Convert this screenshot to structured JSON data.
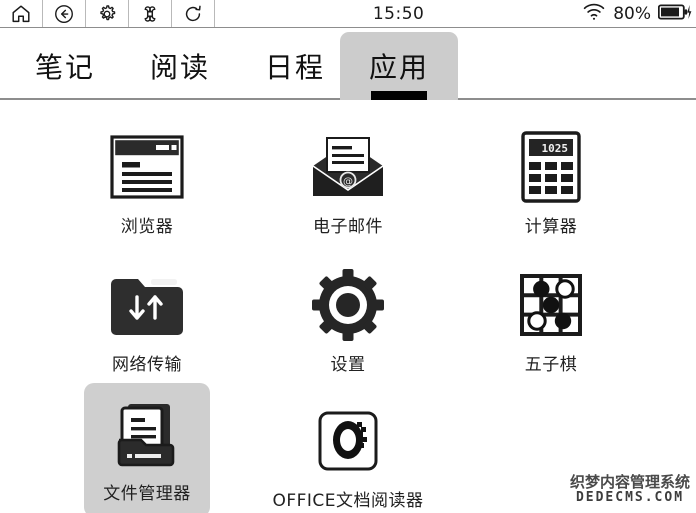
{
  "statusbar": {
    "buttons": [
      {
        "name": "home-icon",
        "label": "home"
      },
      {
        "name": "back-icon",
        "label": "back"
      },
      {
        "name": "gear-icon",
        "label": "settings"
      },
      {
        "name": "apps-grid-icon",
        "label": "apps"
      },
      {
        "name": "refresh-icon",
        "label": "refresh"
      }
    ],
    "time": "15:50",
    "wifi_icon": "wifi-icon",
    "battery_percent": "80%",
    "battery_icon": "battery-charging-icon"
  },
  "tabs": [
    {
      "label": "笔记",
      "active": false
    },
    {
      "label": "阅读",
      "active": false
    },
    {
      "label": "日程",
      "active": false
    },
    {
      "label": "应用",
      "active": true
    }
  ],
  "apps": [
    {
      "label": "浏览器",
      "icon": "browser-icon",
      "selected": false
    },
    {
      "label": "电子邮件",
      "icon": "email-icon",
      "selected": false
    },
    {
      "label": "计算器",
      "icon": "calculator-icon",
      "selected": false,
      "display_value": "1025"
    },
    {
      "label": "网络传输",
      "icon": "network-transfer-folder-icon",
      "selected": false
    },
    {
      "label": "设置",
      "icon": "gear-icon",
      "selected": false
    },
    {
      "label": "五子棋",
      "icon": "gomoku-board-icon",
      "selected": false
    },
    {
      "label": "文件管理器",
      "icon": "file-manager-icon",
      "selected": true
    },
    {
      "label": "OFFICE文档阅读器",
      "icon": "office-reader-icon",
      "selected": false
    }
  ],
  "watermark": {
    "cn": "织梦内容管理系统",
    "en": "DEDECMS.COM"
  },
  "colors": {
    "active_tab_bg": "#cccccc",
    "selected_app_bg": "#cfcfcf",
    "ink": "#111111",
    "divider": "#8d8d8d"
  }
}
